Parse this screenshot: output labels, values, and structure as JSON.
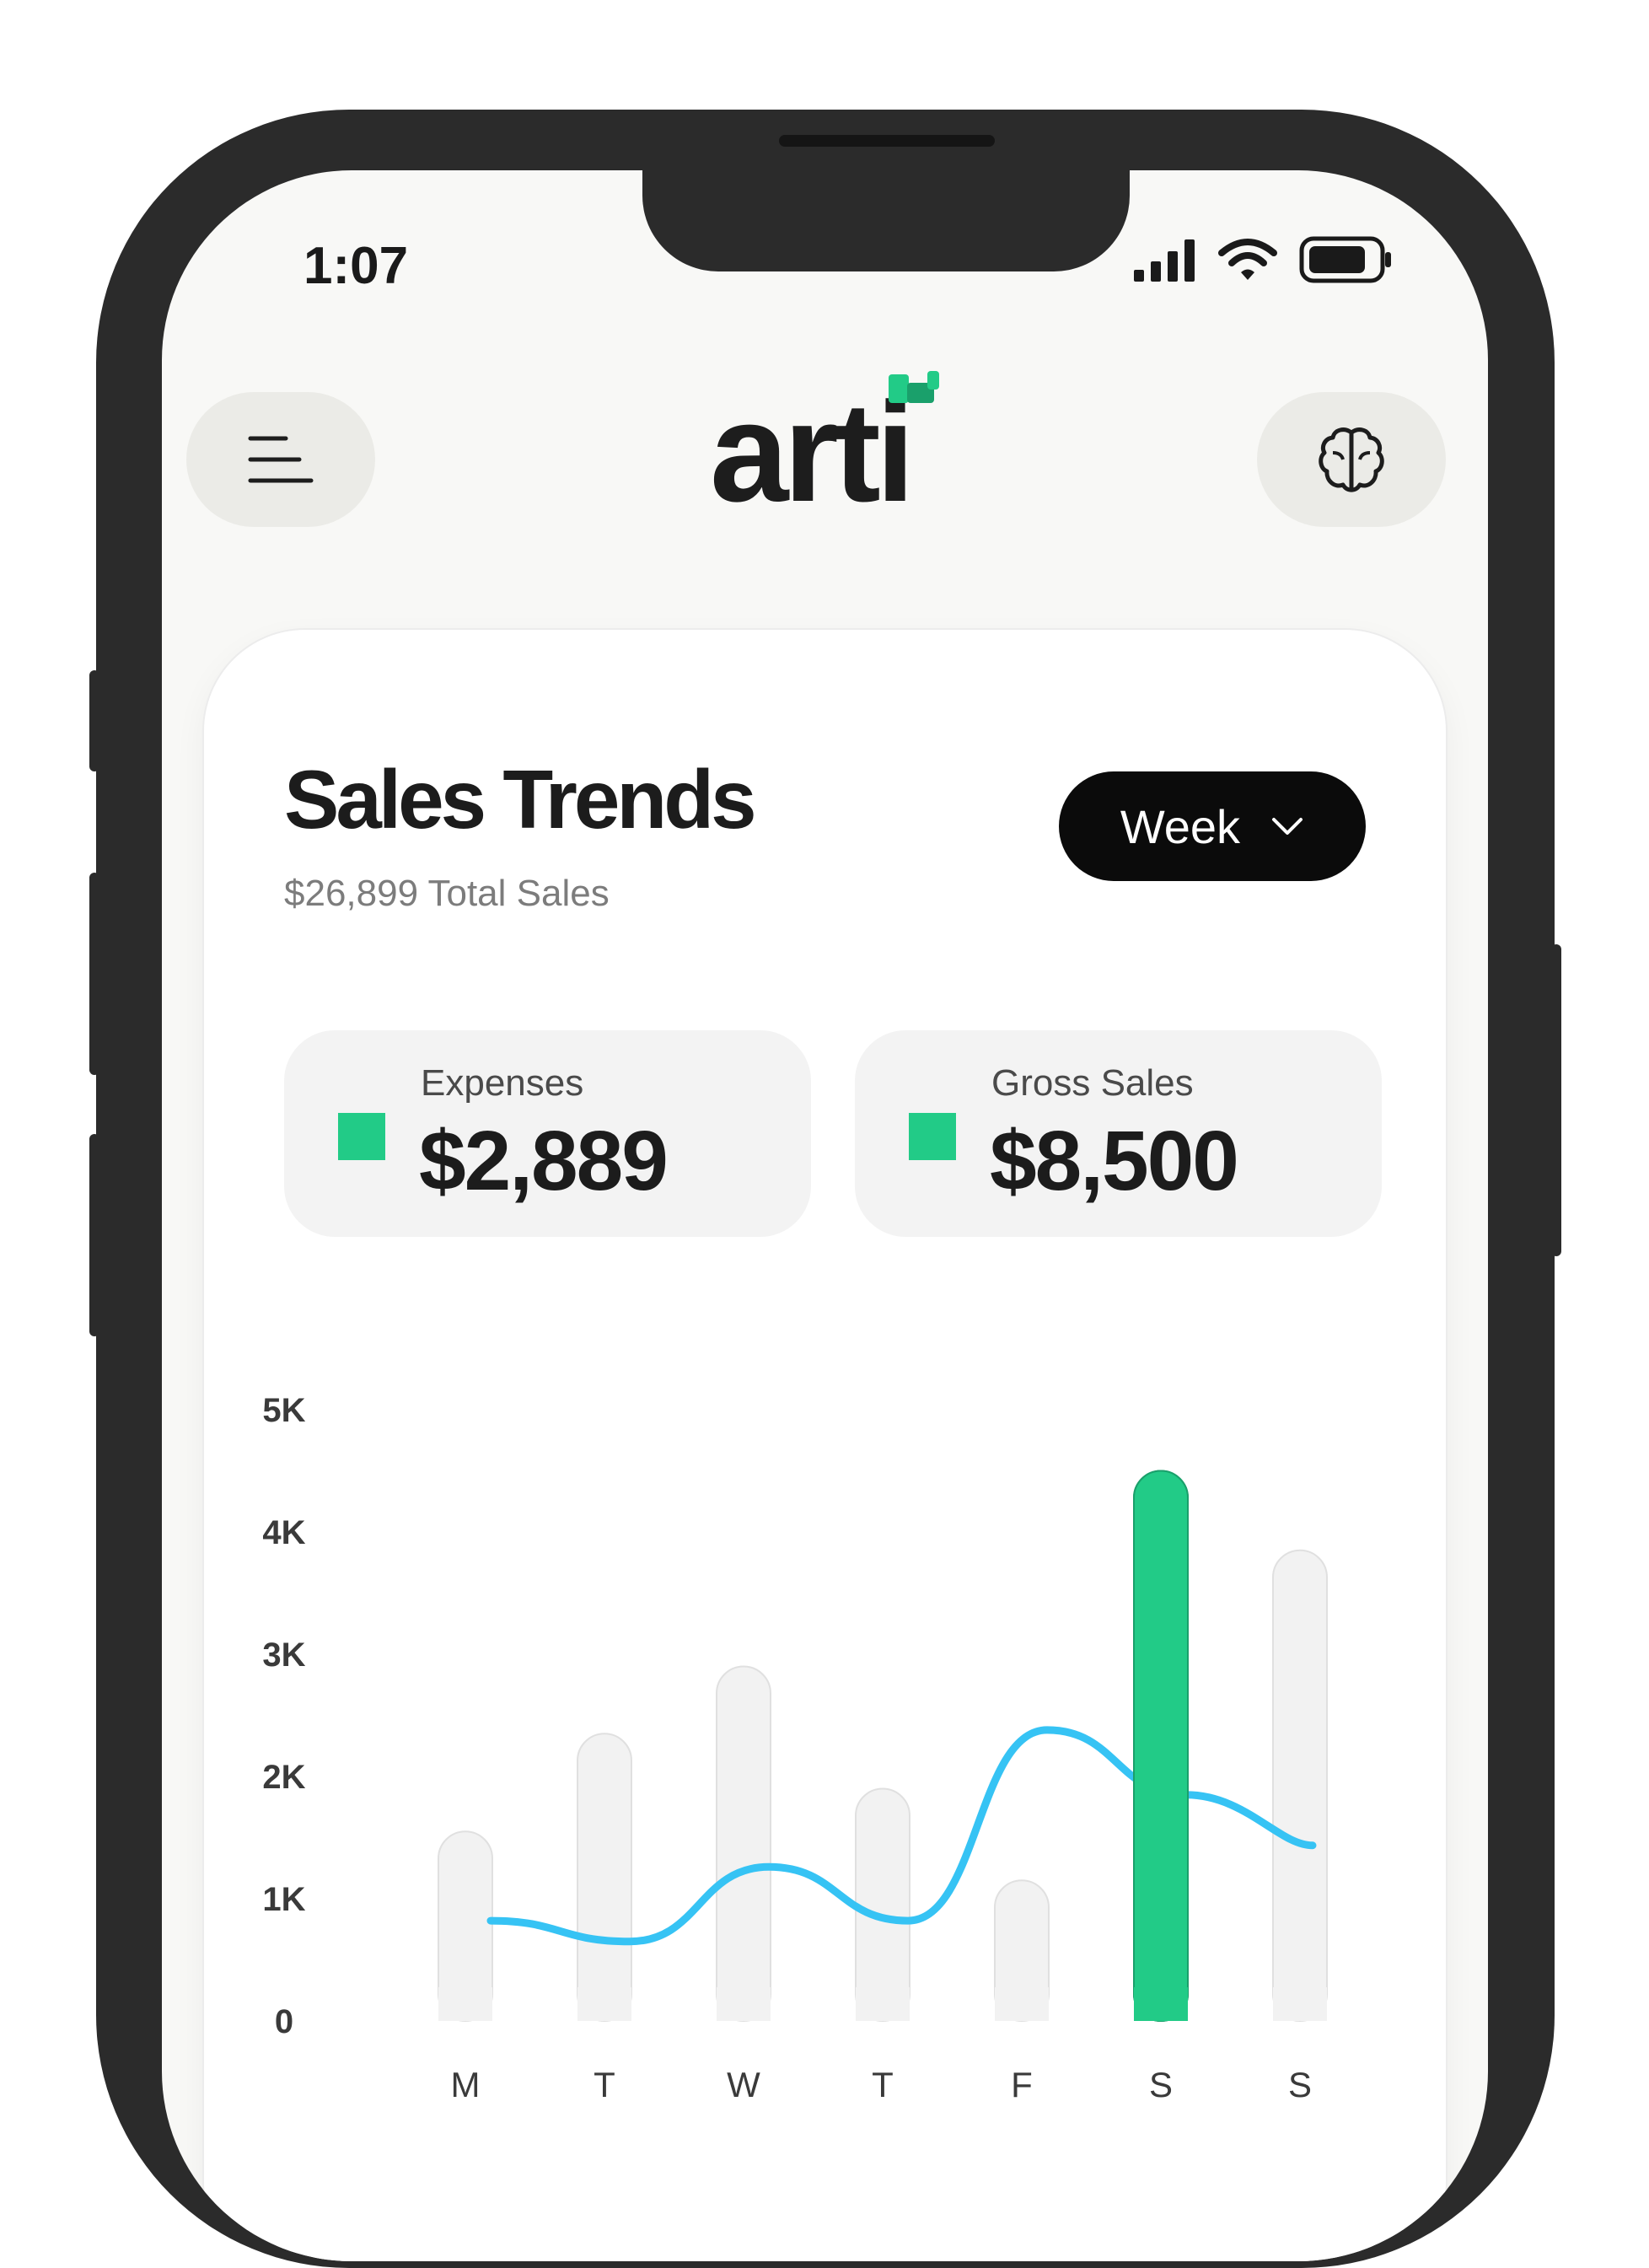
{
  "status_bar": {
    "time": "1:07",
    "icons": [
      "signal-icon",
      "wifi-icon",
      "battery-icon"
    ]
  },
  "header": {
    "menu_icon": "menu-icon",
    "logo_text": "arti",
    "brain_icon": "brain-icon"
  },
  "card": {
    "title": "Sales Trends",
    "subtitle": "$26,899 Total Sales",
    "period_select": "Week",
    "stats": [
      {
        "label": "Expenses",
        "value": "$2,889",
        "color": "#22cb87"
      },
      {
        "label": "Gross Sales",
        "value": "$8,500",
        "color": "#22cb87"
      }
    ]
  },
  "colors": {
    "accent_green": "#22cb87",
    "line_blue": "#36c3f4",
    "bar_gray": "#f2f2f2"
  },
  "chart_data": {
    "type": "bar",
    "categories": [
      "M",
      "T",
      "W",
      "T",
      "F",
      "S",
      "S"
    ],
    "series": [
      {
        "type": "bar",
        "values": [
          1550,
          2350,
          2900,
          1900,
          1150,
          4500,
          3850
        ],
        "highlight_index": 5
      },
      {
        "type": "line",
        "values": [
          820,
          650,
          1260,
          820,
          2380,
          1850
        ]
      }
    ],
    "ylim": [
      0,
      5000
    ],
    "y_ticks": [
      "0",
      "1K",
      "2K",
      "3K",
      "4K",
      "5K"
    ],
    "y_tick_values": [
      0,
      1000,
      2000,
      3000,
      4000,
      5000
    ],
    "grid": false,
    "xlabel": "",
    "ylabel": ""
  }
}
